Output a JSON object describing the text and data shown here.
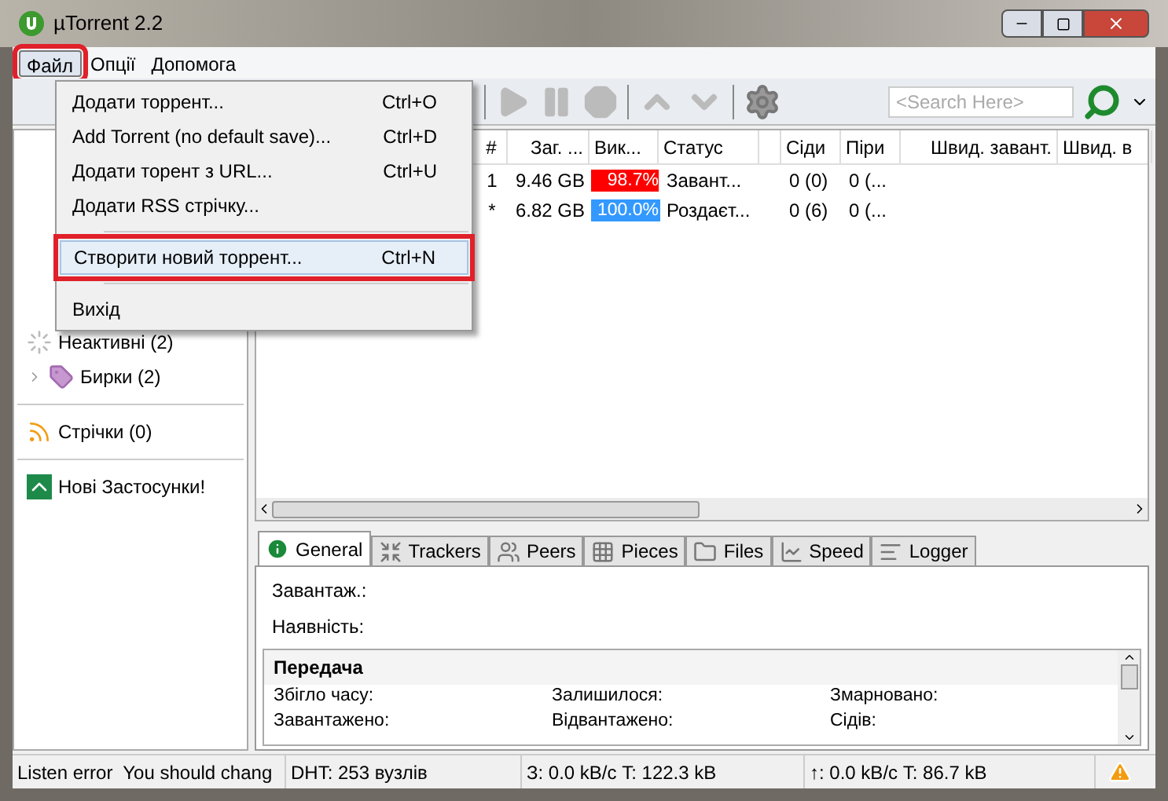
{
  "window": {
    "title": "µTorrent 2.2"
  },
  "menubar": [
    {
      "label": "Файл",
      "selected": true,
      "highlighted": true
    },
    {
      "label": "Опції",
      "selected": false,
      "highlighted": false
    },
    {
      "label": "Допомога",
      "selected": false,
      "highlighted": false
    }
  ],
  "file_menu": [
    {
      "kind": "item",
      "label": "Додати торрент...",
      "shortcut": "Ctrl+O",
      "highlighted": false
    },
    {
      "kind": "item",
      "label": "Add Torrent (no default save)...",
      "shortcut": "Ctrl+D",
      "highlighted": false
    },
    {
      "kind": "item",
      "label": "Додати торент з URL...",
      "shortcut": "Ctrl+U",
      "highlighted": false
    },
    {
      "kind": "item",
      "label": "Додати RSS стрічку...",
      "highlighted": false
    },
    {
      "kind": "separator"
    },
    {
      "kind": "item",
      "label": "Створити новий торрент...",
      "shortcut": "Ctrl+N",
      "highlighted": true
    },
    {
      "kind": "separator"
    },
    {
      "kind": "item",
      "label": "Вихід",
      "highlighted": false
    }
  ],
  "toolbar": {
    "search": {
      "placeholder": "<Search Here>"
    }
  },
  "sidebar": [
    {
      "kind": "inactive",
      "label": "Неактивні (2)"
    },
    {
      "kind": "labels",
      "label": "Бирки (2)",
      "expanded": false
    },
    {
      "kind": "divider"
    },
    {
      "kind": "feeds",
      "label": "Стрічки (0)"
    },
    {
      "kind": "divider"
    },
    {
      "kind": "apps",
      "label": "Нові Застосунки!"
    }
  ],
  "table": {
    "columns": [
      "#",
      "Заг. ...",
      "Вик...",
      "Статус",
      "",
      "Сіди",
      "Піри",
      "Швид. завант.",
      "Швид. в"
    ],
    "rows": [
      {
        "num": "1",
        "size": "9.46 GB",
        "progress": {
          "text": "98.7%",
          "level": 0.987,
          "color": "#ff0000"
        },
        "status": "Завант...",
        "seeds": "0 (0)",
        "peers": "0 (..."
      },
      {
        "num": "*",
        "size": "6.82 GB",
        "progress": {
          "text": "100.0%",
          "level": 1.0,
          "color": "#3399ff"
        },
        "status": "Роздаєт...",
        "seeds": "0 (6)",
        "peers": "0 (..."
      }
    ]
  },
  "tabs": [
    {
      "label": "General",
      "selected": true
    },
    {
      "label": "Trackers",
      "selected": false
    },
    {
      "label": "Peers",
      "selected": false
    },
    {
      "label": "Pieces",
      "selected": false
    },
    {
      "label": "Files",
      "selected": false
    },
    {
      "label": "Speed",
      "selected": false
    },
    {
      "label": "Logger",
      "selected": false
    }
  ],
  "general": {
    "fields": [
      "Завантаж.:",
      "Наявність:"
    ],
    "transfer": {
      "title": "Передача",
      "labels": [
        "Збігло часу:",
        "Залишилося:",
        "Змарновано:",
        "Завантажено:",
        "Відвантажено:",
        "Сідів:"
      ]
    }
  },
  "status_bar": [
    "Listen error  You should chang",
    "DHT: 253 вузлів",
    "З: 0.0 kB/с T: 122.3 kB",
    "↑: 0.0 kB/с T: 86.7 kB"
  ]
}
